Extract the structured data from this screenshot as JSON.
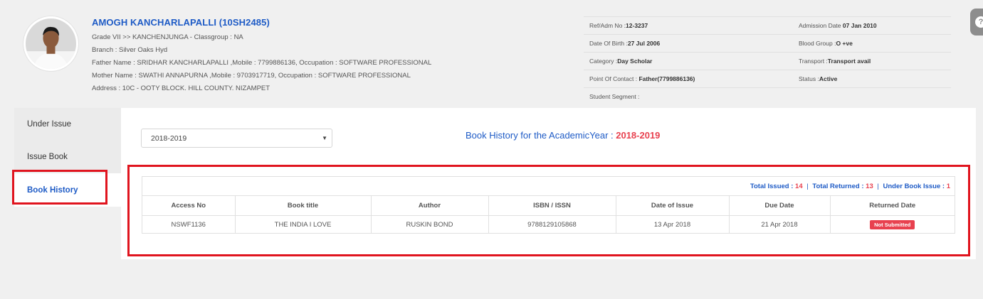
{
  "student": {
    "name": "AMOGH KANCHARLAPALLI (10SH2485)",
    "grade": "Grade VII >> KANCHENJUNGA - Classgroup : NA",
    "branch": "Branch : Silver Oaks Hyd",
    "father": "Father Name : SRIDHAR KANCHARLAPALLI ,Mobile : 7799886136, Occupation : SOFTWARE PROFESSIONAL",
    "mother": "Mother Name : SWATHI ANNAPURNA ,Mobile : 9703917719, Occupation : SOFTWARE PROFESSIONAL",
    "address": "Address : 10C - OOTY BLOCK. HILL COUNTY. NIZAMPET"
  },
  "info": {
    "ref_label": "Ref/Adm No :",
    "ref_value": "12-3237",
    "adm_label": "Admission Date",
    "adm_value": "07 Jan 2010",
    "dob_label": "Date Of Birth :",
    "dob_value": "27 Jul 2006",
    "blood_label": "Blood Group :",
    "blood_value": "O +ve",
    "cat_label": "Category :",
    "cat_value": "Day Scholar",
    "transport_label": "Transport :",
    "transport_value": "Transport avail",
    "poc_label": "Point Of Contact : ",
    "poc_value": "Father(7799886136)",
    "status_label": "Status :",
    "status_value": "Active",
    "segment_label": "Student Segment :",
    "segment_value": ""
  },
  "menu": {
    "items": [
      {
        "label": "Under Issue"
      },
      {
        "label": "Issue Book"
      },
      {
        "label": "Book History"
      }
    ]
  },
  "filter": {
    "selected_year": "2018-2019",
    "caret": "▼"
  },
  "heading": {
    "prefix": "Book History for the AcademicYear : ",
    "year": "2018-2019"
  },
  "totals": {
    "issued_label": "Total Issued : ",
    "issued": "14",
    "returned_label": "Total Returned : ",
    "returned": "13",
    "under_label": "Under Book Issue : ",
    "under": "1",
    "sep": "|"
  },
  "table": {
    "headers": [
      "Access No",
      "Book title",
      "Author",
      "ISBN / ISSN",
      "Date of Issue",
      "Due Date",
      "Returned Date"
    ],
    "rows": [
      {
        "access": "NSWF1136",
        "title": "THE INDIA I LOVE",
        "author": "RUSKIN BOND",
        "isbn": "9788129105868",
        "issue": "13 Apr 2018",
        "due": "21 Apr 2018",
        "returned": "Not Submitted"
      }
    ]
  },
  "colors": {
    "accent": "#1e5bc6",
    "danger": "#e8414f",
    "highlight": "#e0141e"
  },
  "help_icon": "?"
}
